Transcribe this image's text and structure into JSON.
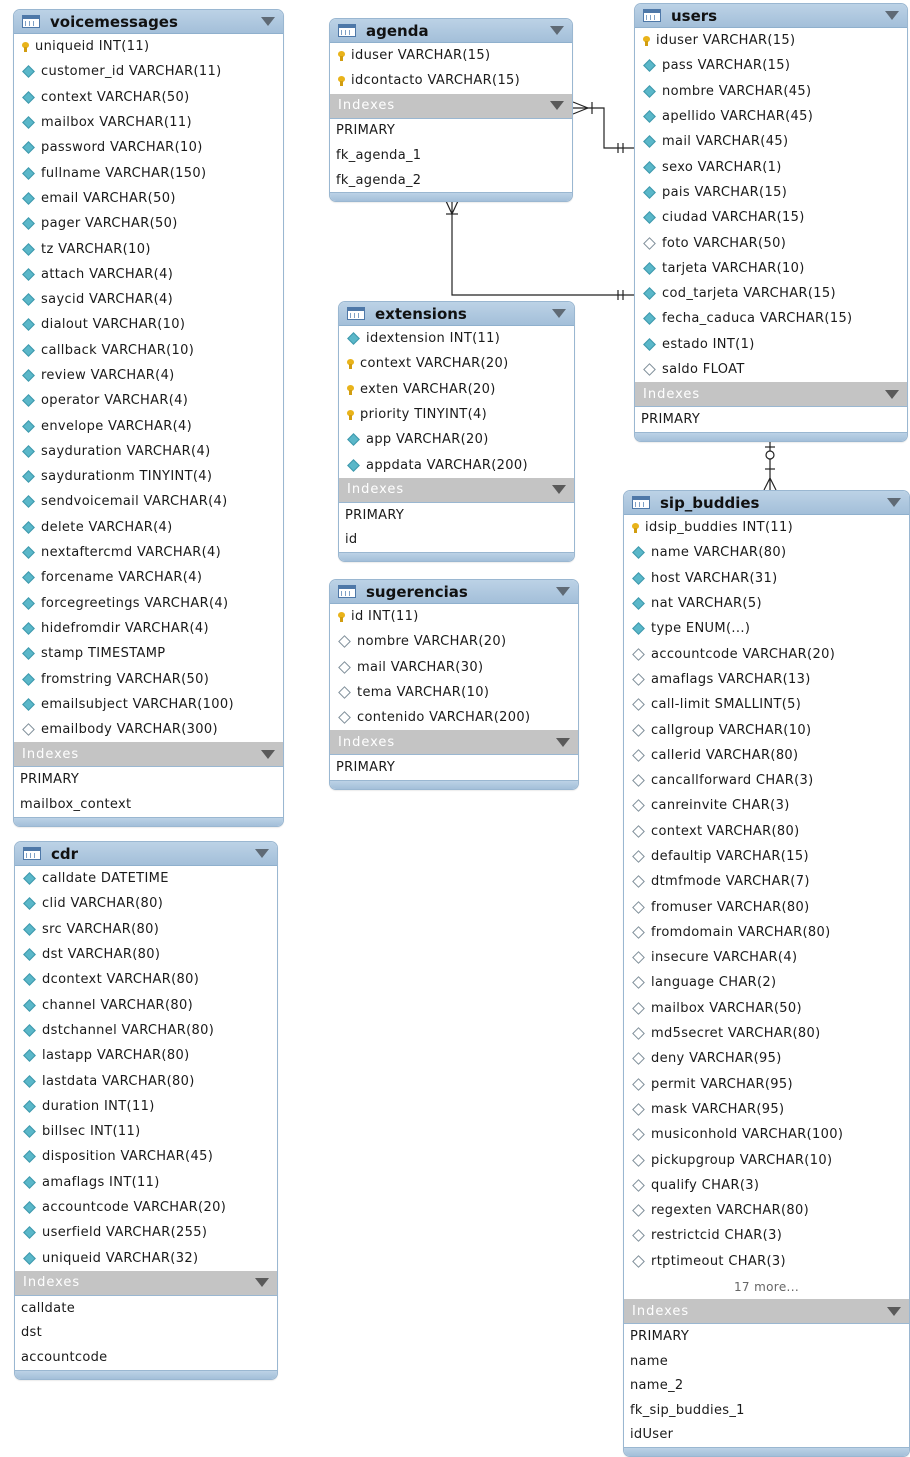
{
  "tables": {
    "voicemessages": {
      "name": "voicemessages",
      "indexes_label": "Indexes",
      "columns": [
        {
          "icon": "key",
          "label": "uniqueid INT(11)"
        },
        {
          "icon": "diamond",
          "label": "customer_id VARCHAR(11)"
        },
        {
          "icon": "diamond",
          "label": "context VARCHAR(50)"
        },
        {
          "icon": "diamond",
          "label": "mailbox VARCHAR(11)"
        },
        {
          "icon": "diamond",
          "label": "password VARCHAR(10)"
        },
        {
          "icon": "diamond",
          "label": "fullname VARCHAR(150)"
        },
        {
          "icon": "diamond",
          "label": "email VARCHAR(50)"
        },
        {
          "icon": "diamond",
          "label": "pager VARCHAR(50)"
        },
        {
          "icon": "diamond",
          "label": "tz VARCHAR(10)"
        },
        {
          "icon": "diamond",
          "label": "attach VARCHAR(4)"
        },
        {
          "icon": "diamond",
          "label": "saycid VARCHAR(4)"
        },
        {
          "icon": "diamond",
          "label": "dialout VARCHAR(10)"
        },
        {
          "icon": "diamond",
          "label": "callback VARCHAR(10)"
        },
        {
          "icon": "diamond",
          "label": "review VARCHAR(4)"
        },
        {
          "icon": "diamond",
          "label": "operator VARCHAR(4)"
        },
        {
          "icon": "diamond",
          "label": "envelope VARCHAR(4)"
        },
        {
          "icon": "diamond",
          "label": "sayduration VARCHAR(4)"
        },
        {
          "icon": "diamond",
          "label": "saydurationm TINYINT(4)"
        },
        {
          "icon": "diamond",
          "label": "sendvoicemail VARCHAR(4)"
        },
        {
          "icon": "diamond",
          "label": "delete VARCHAR(4)"
        },
        {
          "icon": "diamond",
          "label": "nextaftercmd VARCHAR(4)"
        },
        {
          "icon": "diamond",
          "label": "forcename VARCHAR(4)"
        },
        {
          "icon": "diamond",
          "label": "forcegreetings VARCHAR(4)"
        },
        {
          "icon": "diamond",
          "label": "hidefromdir VARCHAR(4)"
        },
        {
          "icon": "diamond",
          "label": "stamp TIMESTAMP"
        },
        {
          "icon": "diamond",
          "label": "fromstring VARCHAR(50)"
        },
        {
          "icon": "diamond",
          "label": "emailsubject VARCHAR(100)"
        },
        {
          "icon": "hollow",
          "label": "emailbody VARCHAR(300)"
        }
      ],
      "indexes": [
        "PRIMARY",
        "mailbox_context"
      ]
    },
    "cdr": {
      "name": "cdr",
      "indexes_label": "Indexes",
      "columns": [
        {
          "icon": "diamond",
          "label": "calldate DATETIME"
        },
        {
          "icon": "diamond",
          "label": "clid VARCHAR(80)"
        },
        {
          "icon": "diamond",
          "label": "src VARCHAR(80)"
        },
        {
          "icon": "diamond",
          "label": "dst VARCHAR(80)"
        },
        {
          "icon": "diamond",
          "label": "dcontext VARCHAR(80)"
        },
        {
          "icon": "diamond",
          "label": "channel VARCHAR(80)"
        },
        {
          "icon": "diamond",
          "label": "dstchannel VARCHAR(80)"
        },
        {
          "icon": "diamond",
          "label": "lastapp VARCHAR(80)"
        },
        {
          "icon": "diamond",
          "label": "lastdata VARCHAR(80)"
        },
        {
          "icon": "diamond",
          "label": "duration INT(11)"
        },
        {
          "icon": "diamond",
          "label": "billsec INT(11)"
        },
        {
          "icon": "diamond",
          "label": "disposition VARCHAR(45)"
        },
        {
          "icon": "diamond",
          "label": "amaflags INT(11)"
        },
        {
          "icon": "diamond",
          "label": "accountcode VARCHAR(20)"
        },
        {
          "icon": "diamond",
          "label": "userfield VARCHAR(255)"
        },
        {
          "icon": "diamond",
          "label": "uniqueid VARCHAR(32)"
        }
      ],
      "indexes": [
        "calldate",
        "dst",
        "accountcode"
      ]
    },
    "agenda": {
      "name": "agenda",
      "indexes_label": "Indexes",
      "columns": [
        {
          "icon": "key",
          "label": "iduser VARCHAR(15)"
        },
        {
          "icon": "key",
          "label": "idcontacto VARCHAR(15)"
        }
      ],
      "indexes": [
        "PRIMARY",
        "fk_agenda_1",
        "fk_agenda_2"
      ]
    },
    "extensions": {
      "name": "extensions",
      "indexes_label": "Indexes",
      "columns": [
        {
          "icon": "diamond",
          "label": "idextension INT(11)"
        },
        {
          "icon": "key",
          "label": "context VARCHAR(20)"
        },
        {
          "icon": "key",
          "label": "exten VARCHAR(20)"
        },
        {
          "icon": "key",
          "label": "priority TINYINT(4)"
        },
        {
          "icon": "diamond",
          "label": "app VARCHAR(20)"
        },
        {
          "icon": "diamond",
          "label": "appdata VARCHAR(200)"
        }
      ],
      "indexes": [
        "PRIMARY",
        "id"
      ]
    },
    "sugerencias": {
      "name": "sugerencias",
      "indexes_label": "Indexes",
      "columns": [
        {
          "icon": "key",
          "label": "id INT(11)"
        },
        {
          "icon": "hollow",
          "label": "nombre VARCHAR(20)"
        },
        {
          "icon": "hollow",
          "label": "mail VARCHAR(30)"
        },
        {
          "icon": "hollow",
          "label": "tema VARCHAR(10)"
        },
        {
          "icon": "hollow",
          "label": "contenido VARCHAR(200)"
        }
      ],
      "indexes": [
        "PRIMARY"
      ]
    },
    "users": {
      "name": "users",
      "indexes_label": "Indexes",
      "columns": [
        {
          "icon": "key",
          "label": "iduser VARCHAR(15)"
        },
        {
          "icon": "diamond",
          "label": "pass VARCHAR(15)"
        },
        {
          "icon": "diamond",
          "label": "nombre VARCHAR(45)"
        },
        {
          "icon": "diamond",
          "label": "apellido VARCHAR(45)"
        },
        {
          "icon": "diamond",
          "label": "mail VARCHAR(45)"
        },
        {
          "icon": "diamond",
          "label": "sexo VARCHAR(1)"
        },
        {
          "icon": "diamond",
          "label": "pais VARCHAR(15)"
        },
        {
          "icon": "diamond",
          "label": "ciudad VARCHAR(15)"
        },
        {
          "icon": "hollow",
          "label": "foto VARCHAR(50)"
        },
        {
          "icon": "diamond",
          "label": "tarjeta VARCHAR(10)"
        },
        {
          "icon": "diamond",
          "label": "cod_tarjeta VARCHAR(15)"
        },
        {
          "icon": "diamond",
          "label": "fecha_caduca VARCHAR(15)"
        },
        {
          "icon": "diamond",
          "label": "estado INT(1)"
        },
        {
          "icon": "hollow",
          "label": "saldo FLOAT"
        }
      ],
      "indexes": [
        "PRIMARY"
      ]
    },
    "sip_buddies": {
      "name": "sip_buddies",
      "indexes_label": "Indexes",
      "columns": [
        {
          "icon": "key",
          "label": "idsip_buddies INT(11)"
        },
        {
          "icon": "diamond",
          "label": "name VARCHAR(80)"
        },
        {
          "icon": "diamond",
          "label": "host VARCHAR(31)"
        },
        {
          "icon": "diamond",
          "label": "nat VARCHAR(5)"
        },
        {
          "icon": "diamond",
          "label": "type ENUM(...)"
        },
        {
          "icon": "hollow",
          "label": "accountcode VARCHAR(20)"
        },
        {
          "icon": "hollow",
          "label": "amaflags VARCHAR(13)"
        },
        {
          "icon": "hollow",
          "label": "call-limit SMALLINT(5)"
        },
        {
          "icon": "hollow",
          "label": "callgroup VARCHAR(10)"
        },
        {
          "icon": "hollow",
          "label": "callerid VARCHAR(80)"
        },
        {
          "icon": "hollow",
          "label": "cancallforward CHAR(3)"
        },
        {
          "icon": "hollow",
          "label": "canreinvite CHAR(3)"
        },
        {
          "icon": "hollow",
          "label": "context VARCHAR(80)"
        },
        {
          "icon": "hollow",
          "label": "defaultip VARCHAR(15)"
        },
        {
          "icon": "hollow",
          "label": "dtmfmode VARCHAR(7)"
        },
        {
          "icon": "hollow",
          "label": "fromuser VARCHAR(80)"
        },
        {
          "icon": "hollow",
          "label": "fromdomain VARCHAR(80)"
        },
        {
          "icon": "hollow",
          "label": "insecure VARCHAR(4)"
        },
        {
          "icon": "hollow",
          "label": "language CHAR(2)"
        },
        {
          "icon": "hollow",
          "label": "mailbox VARCHAR(50)"
        },
        {
          "icon": "hollow",
          "label": "md5secret VARCHAR(80)"
        },
        {
          "icon": "hollow",
          "label": "deny VARCHAR(95)"
        },
        {
          "icon": "hollow",
          "label": "permit VARCHAR(95)"
        },
        {
          "icon": "hollow",
          "label": "mask VARCHAR(95)"
        },
        {
          "icon": "hollow",
          "label": "musiconhold VARCHAR(100)"
        },
        {
          "icon": "hollow",
          "label": "pickupgroup VARCHAR(10)"
        },
        {
          "icon": "hollow",
          "label": "qualify CHAR(3)"
        },
        {
          "icon": "hollow",
          "label": "regexten VARCHAR(80)"
        },
        {
          "icon": "hollow",
          "label": "restrictcid CHAR(3)"
        },
        {
          "icon": "hollow",
          "label": "rtptimeout CHAR(3)"
        }
      ],
      "more_label": "17 more...",
      "indexes": [
        "PRIMARY",
        "name",
        "name_2",
        "fk_sip_buddies_1",
        "idUser"
      ]
    }
  },
  "relationships": [
    {
      "from": "agenda",
      "to": "users",
      "notation": "many-to-one"
    },
    {
      "from": "agenda",
      "to": "users",
      "notation": "many-to-one"
    },
    {
      "from": "sip_buddies",
      "to": "users",
      "notation": "zero-or-many-to-one"
    }
  ]
}
